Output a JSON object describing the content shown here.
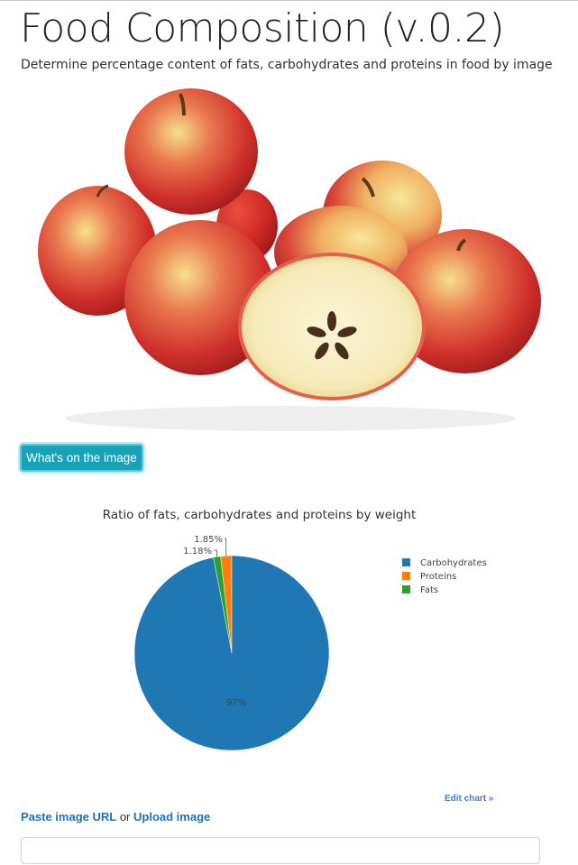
{
  "header": {
    "title": "Food Composition (v.0.2)",
    "subtitle": "Determine percentage content of fats, carbohydrates and proteins in food by image"
  },
  "image": {
    "subject": "apples"
  },
  "actions": {
    "whats_on_image_label": "What's on the image",
    "edit_chart_label": "Edit chart »",
    "paste_url_label": "Paste image URL",
    "or_text": " or ",
    "upload_label": "Upload image"
  },
  "url_input": {
    "value": "",
    "placeholder": ""
  },
  "colors": {
    "accent": "#17a2b8",
    "link": "#1a73c8"
  },
  "chart_data": {
    "type": "pie",
    "title": "Ratio of fats, carbohydrates and proteins by weight",
    "slices": [
      {
        "name": "Carbohydrates",
        "value": 97,
        "label": "97%",
        "color": "#1f77b4"
      },
      {
        "name": "Proteins",
        "value": 1.85,
        "label": "1.85%",
        "color": "#ff7f0e"
      },
      {
        "name": "Fats",
        "value": 1.18,
        "label": "1.18%",
        "color": "#2ca02c"
      }
    ],
    "legend_position": "right"
  }
}
